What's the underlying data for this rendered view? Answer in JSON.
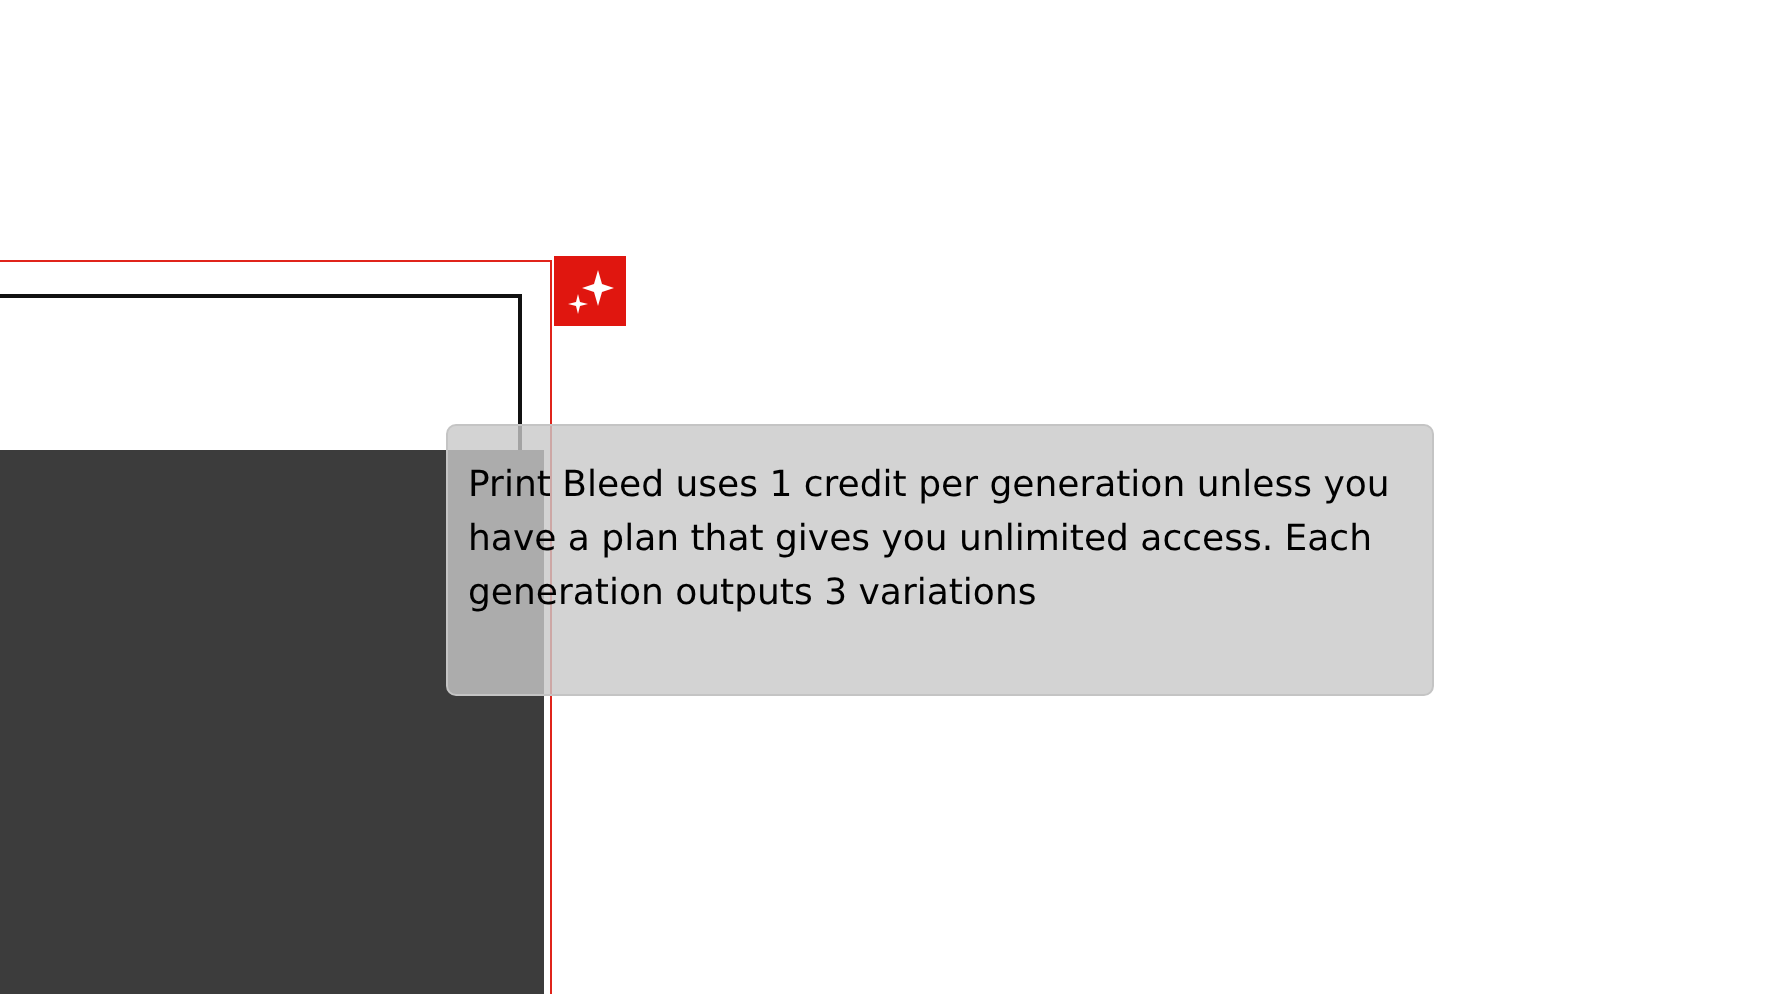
{
  "tooltip": {
    "text": "Print Bleed uses 1 credit per generation unless you have a plan that gives you unlimited access. Each generation outputs 3 variations"
  }
}
